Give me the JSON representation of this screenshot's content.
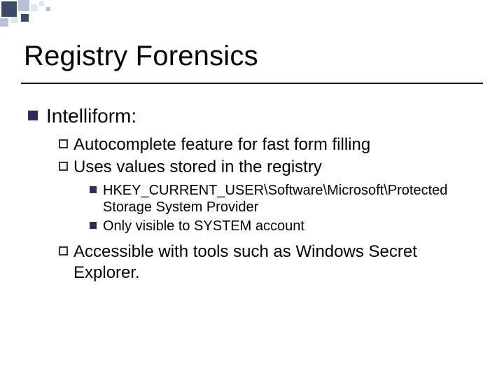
{
  "title": "Registry Forensics",
  "bullets": {
    "lvl1": {
      "text": "Intelliform:"
    },
    "lvl2": [
      {
        "text": "Autocomplete feature for fast form filling"
      },
      {
        "text": "Uses values stored in the registry"
      },
      {
        "text": "Accessible with tools such as Windows Secret Explorer."
      }
    ],
    "lvl3": [
      {
        "text": "HKEY_CURRENT_USER\\Software\\Microsoft\\Protected Storage System Provider"
      },
      {
        "text": "Only visible to SYSTEM account"
      }
    ]
  }
}
